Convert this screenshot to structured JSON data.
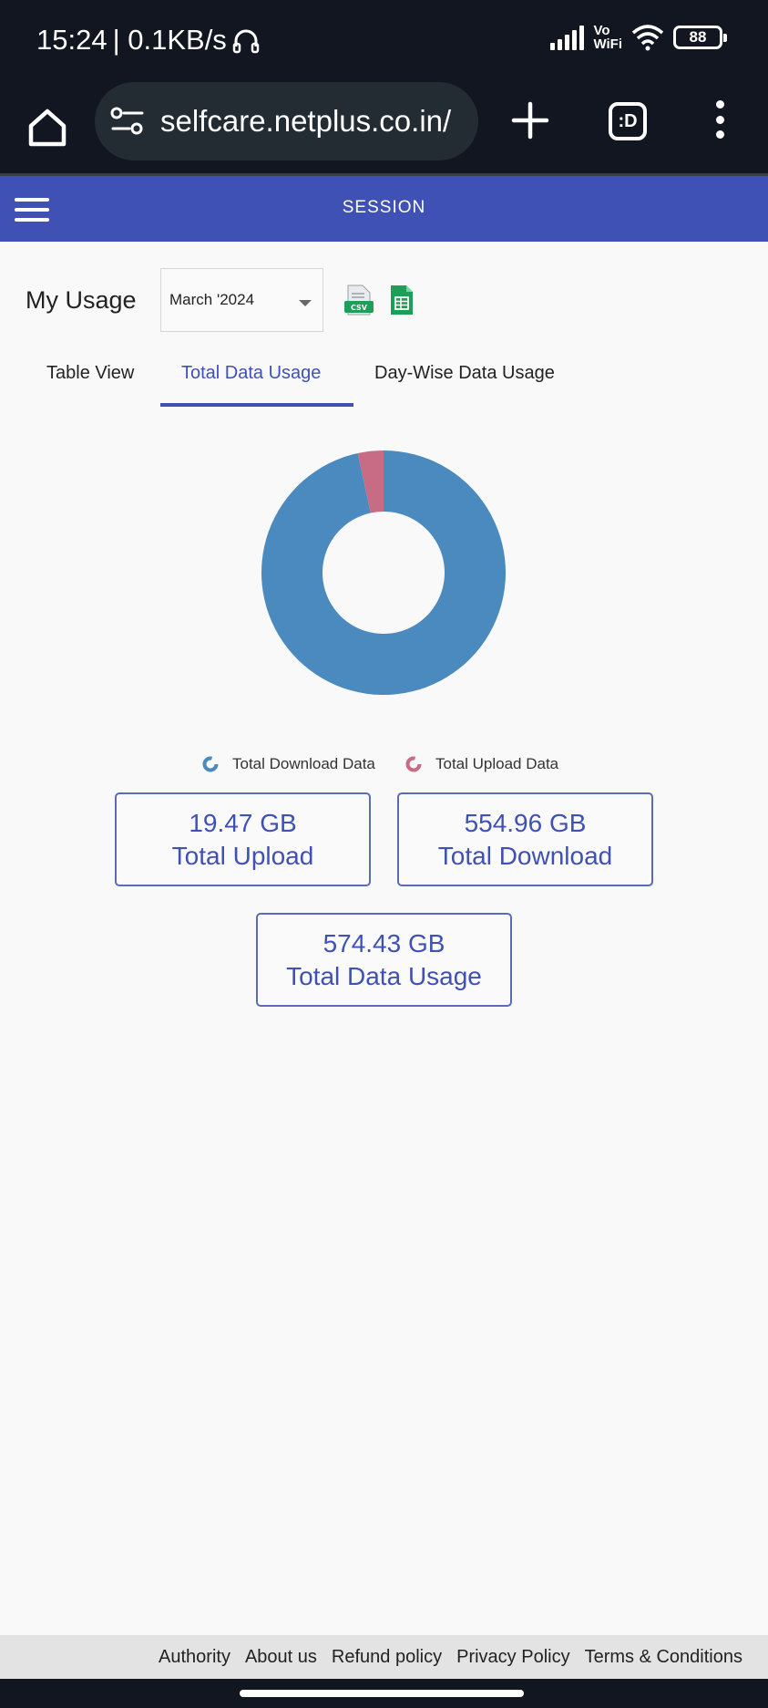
{
  "status_bar": {
    "time": "15:24",
    "speed": "| 0.1KB/s",
    "vowifi_top": "Vo",
    "vowifi_bottom": "WiFi",
    "battery": "88"
  },
  "browser": {
    "url": "selfcare.netplus.co.in/",
    "tabs_label": ":D"
  },
  "app_header": {
    "title": "SESSION"
  },
  "usage": {
    "label": "My Usage",
    "month": "March '2024",
    "csv_icon_text": "CSV"
  },
  "tabs": [
    {
      "label": "Table View",
      "active": false
    },
    {
      "label": "Total Data Usage",
      "active": true
    },
    {
      "label": "Day-Wise Data Usage",
      "active": false
    }
  ],
  "chart_data": {
    "type": "pie",
    "donut": true,
    "categories": [
      "Total Download Data",
      "Total Upload Data"
    ],
    "values": [
      554.96,
      19.47
    ],
    "colors": [
      "#4a8abf",
      "#c86b84"
    ]
  },
  "legend": {
    "download": "Total Download Data",
    "upload": "Total Upload Data"
  },
  "stats": {
    "upload": {
      "value": "19.47 GB",
      "label": "Total Upload"
    },
    "download": {
      "value": "554.96 GB",
      "label": "Total Download"
    },
    "total": {
      "value": "574.43 GB",
      "label": "Total Data Usage"
    }
  },
  "footer": {
    "links": [
      "Authority",
      "About us",
      "Refund policy",
      "Privacy Policy",
      "Terms & Conditions"
    ]
  }
}
